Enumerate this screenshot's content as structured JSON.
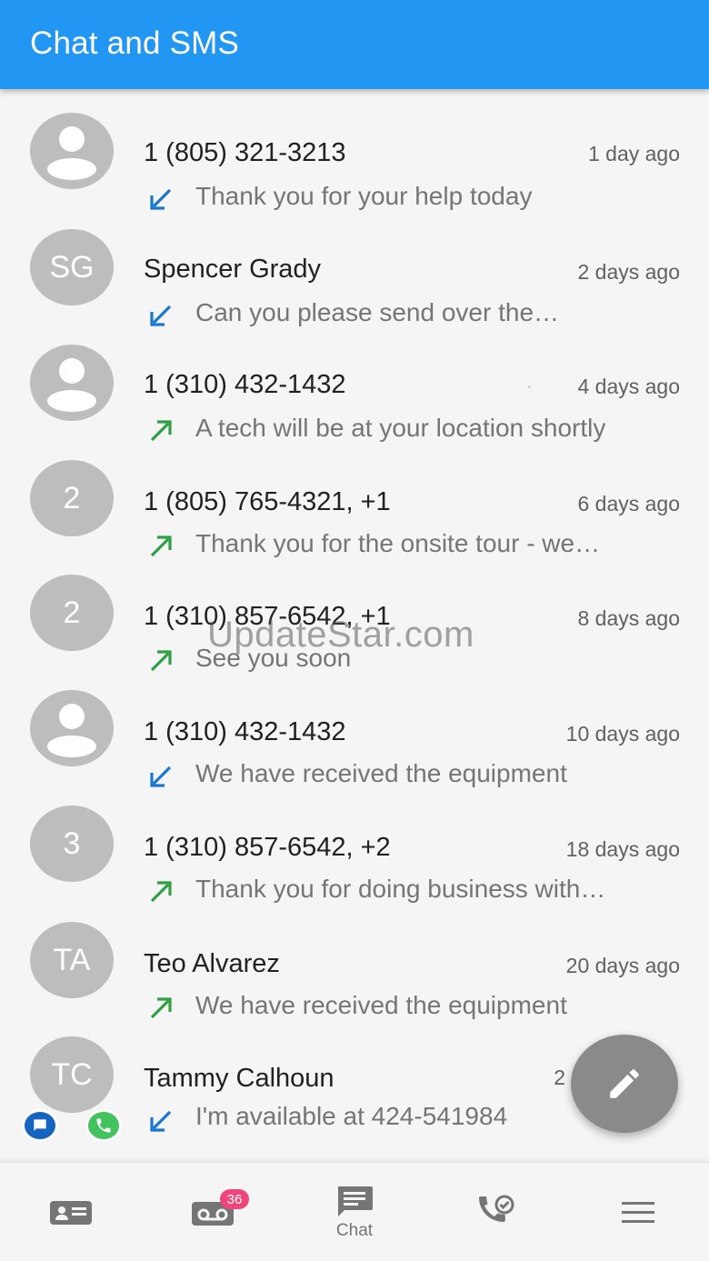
{
  "app_bar": {
    "title": "Chat and SMS"
  },
  "conversations": [
    {
      "avatar_type": "person-icon",
      "initials": "",
      "name": "1 (805) 321-3213",
      "time": "1 day ago",
      "direction": "incoming",
      "preview": "Thank you for your help today"
    },
    {
      "avatar_type": "initials",
      "initials": "SG",
      "name": "Spencer Grady",
      "time": "2 days ago",
      "direction": "incoming",
      "preview": "Can you please send over the…"
    },
    {
      "avatar_type": "person-icon",
      "initials": "",
      "name": "1 (310) 432-1432",
      "time": "4 days ago",
      "direction": "outgoing",
      "preview": "A tech will be at your location shortly"
    },
    {
      "avatar_type": "initials",
      "initials": "2",
      "name": "1 (805) 765-4321, +1",
      "time": "6 days ago",
      "direction": "outgoing",
      "preview": "Thank you for the onsite tour - we…"
    },
    {
      "avatar_type": "initials",
      "initials": "2",
      "name": "1 (310) 857-6542, +1",
      "time": "8 days ago",
      "direction": "outgoing",
      "preview": "See you soon"
    },
    {
      "avatar_type": "person-icon",
      "initials": "",
      "name": "1 (310) 432-1432",
      "time": "10 days ago",
      "direction": "incoming",
      "preview": "We have received the equipment"
    },
    {
      "avatar_type": "initials",
      "initials": "3",
      "name": "1 (310) 857-6542, +2",
      "time": "18 days ago",
      "direction": "outgoing",
      "preview": "Thank you for doing business with…"
    },
    {
      "avatar_type": "initials",
      "initials": "TA",
      "name": "Teo Alvarez",
      "time": "20 days ago",
      "direction": "outgoing",
      "preview": "We have received the equipment"
    },
    {
      "avatar_type": "initials",
      "initials": "TC",
      "name": "Tammy Calhoun",
      "time": "2",
      "direction": "incoming",
      "preview": "I'm available at 424-541984"
    }
  ],
  "watermark": "UpdateStar.com",
  "bottom_nav": {
    "items": [
      {
        "icon": "contacts-card-icon",
        "label": ""
      },
      {
        "icon": "voicemail-icon",
        "label": "",
        "badge": "36"
      },
      {
        "icon": "chat-icon",
        "label": "Chat",
        "active": true
      },
      {
        "icon": "call-history-icon",
        "label": ""
      },
      {
        "icon": "menu-icon",
        "label": ""
      }
    ]
  },
  "colors": {
    "app_bar": "#2196f3",
    "incoming_arrow": "#1976d2",
    "outgoing_arrow": "#2ea043",
    "badge": "#f0457a",
    "fab": "#8a8a8a"
  }
}
